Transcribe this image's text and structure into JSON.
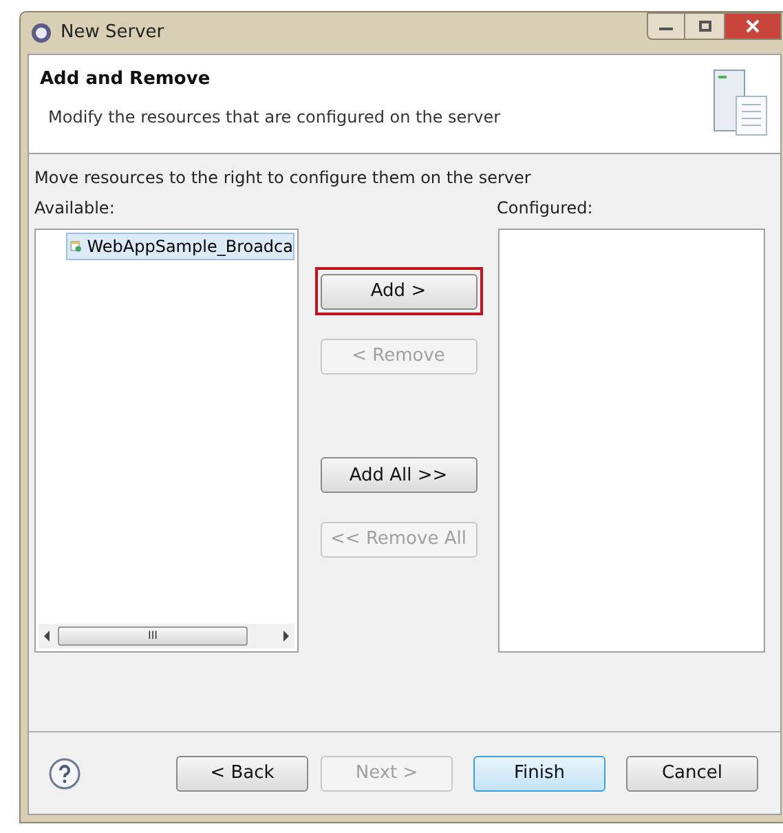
{
  "window": {
    "title": "New Server"
  },
  "header": {
    "title": "Add and Remove",
    "description": "Modify the resources that are configured on the server"
  },
  "instruction": "Move resources to the right to configure them on the server",
  "available": {
    "label": "Available:",
    "items": [
      {
        "label": "WebAppSample_Broadca",
        "selected": true
      }
    ]
  },
  "configured": {
    "label": "Configured:"
  },
  "transfer_buttons": [
    {
      "label": "Add >",
      "disabled": false,
      "highlighted": true
    },
    {
      "label": "< Remove",
      "disabled": true,
      "highlighted": false
    },
    {
      "label": "Add All >>",
      "disabled": false,
      "highlighted": false
    },
    {
      "label": "<< Remove All",
      "disabled": true,
      "highlighted": false
    }
  ],
  "scrollbar_thumb": "III",
  "footer_buttons": [
    {
      "label": "< Back",
      "disabled": false,
      "default": false
    },
    {
      "label": "Next >",
      "disabled": true,
      "default": false
    },
    {
      "label": "Finish",
      "disabled": false,
      "default": true
    },
    {
      "label": "Cancel",
      "disabled": false,
      "default": false
    }
  ]
}
